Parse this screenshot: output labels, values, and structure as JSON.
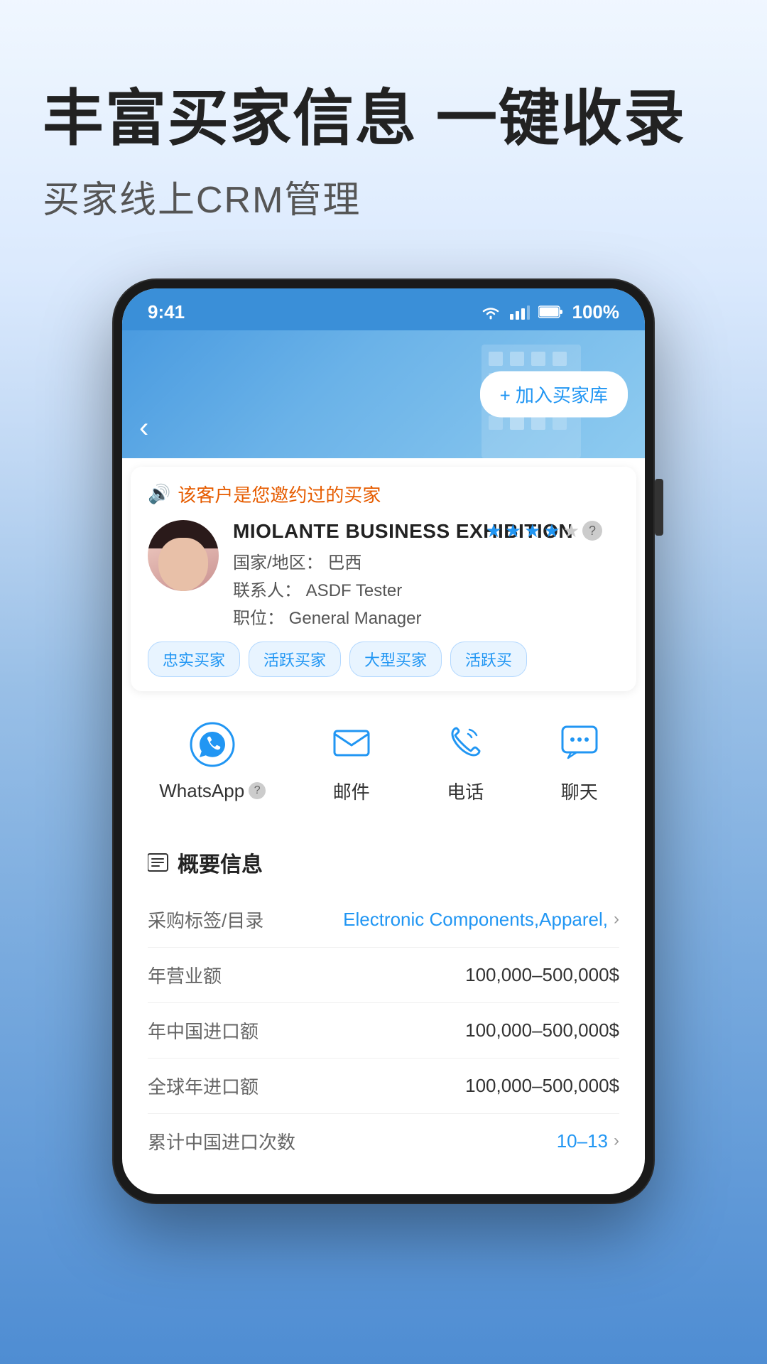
{
  "page": {
    "hero_title": "丰富买家信息 一键收录",
    "hero_subtitle": "买家线上CRM管理"
  },
  "phone": {
    "status_bar": {
      "time": "9:41",
      "battery": "100%"
    },
    "header": {
      "back_label": "‹",
      "add_button": "+ 加入买家库"
    },
    "notice": {
      "text": "该客户是您邀约过的买家"
    },
    "customer": {
      "company": "MIOLANTE BUSINESS EXHIBITION",
      "country_label": "国家/地区：",
      "country": "巴西",
      "contact_label": "联系人：",
      "contact": "ASDF Tester",
      "position_label": "职位：",
      "position": "General Manager",
      "stars": [
        true,
        true,
        true,
        true,
        false
      ],
      "tags": [
        "忠实买家",
        "活跃买家",
        "大型买家",
        "活跃买"
      ]
    },
    "actions": [
      {
        "id": "whatsapp",
        "label": "WhatsApp",
        "has_help": true
      },
      {
        "id": "email",
        "label": "邮件",
        "has_help": false
      },
      {
        "id": "phone",
        "label": "电话",
        "has_help": false
      },
      {
        "id": "chat",
        "label": "聊天",
        "has_help": false
      }
    ],
    "info_section": {
      "title": "概要信息",
      "rows": [
        {
          "label": "采购标签/目录",
          "value": "Electronic Components,Apparel,",
          "has_chevron": true
        },
        {
          "label": "年营业额",
          "value": "100,000–500,000$",
          "has_chevron": false
        },
        {
          "label": "年中国进口额",
          "value": "100,000–500,000$",
          "has_chevron": false
        },
        {
          "label": "全球年进口额",
          "value": "100,000–500,000$",
          "has_chevron": false
        },
        {
          "label": "累计中国进口次数",
          "value": "10–13",
          "has_chevron": true
        }
      ]
    }
  },
  "colors": {
    "primary": "#2196F3",
    "accent_orange": "#e65c00",
    "text_dark": "#222222",
    "text_gray": "#666666"
  }
}
